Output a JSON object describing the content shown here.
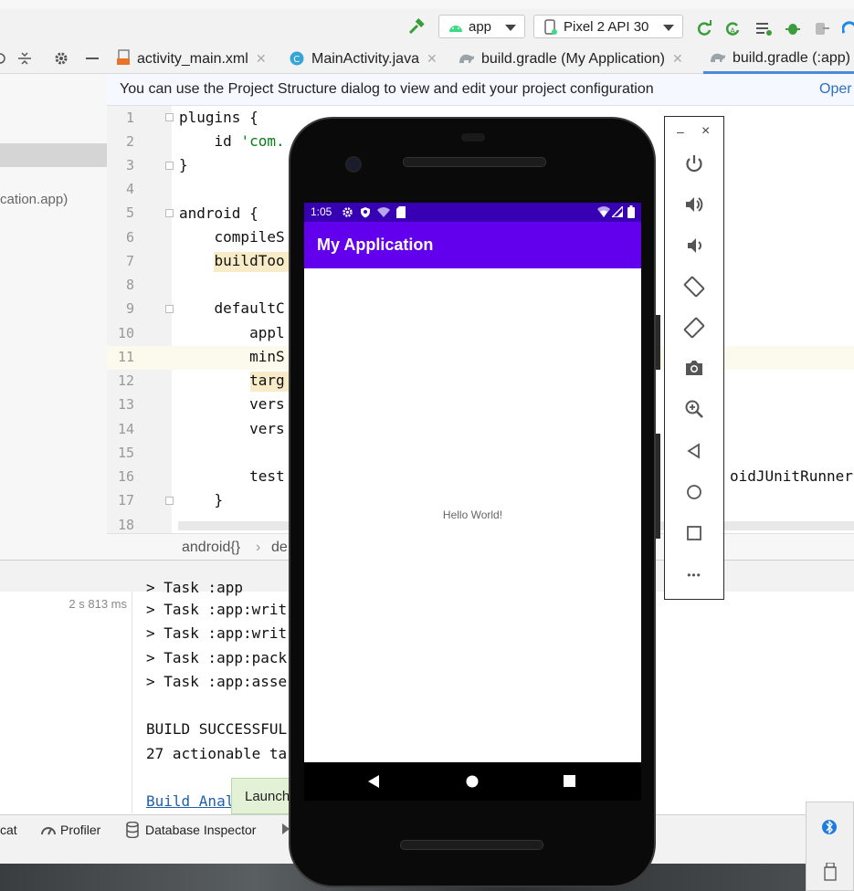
{
  "toolbar": {
    "run_config": "app",
    "device": "Pixel 2 API 30"
  },
  "tabs": [
    {
      "label": "activity_main.xml"
    },
    {
      "label": "MainActivity.java"
    },
    {
      "label": "build.gradle (My Application)"
    },
    {
      "label": "build.gradle (:app)"
    }
  ],
  "left_panel": {
    "project_item": "cation.app)"
  },
  "notice": {
    "text": "You can use the Project Structure dialog to view and edit your project configuration",
    "action": "Oper"
  },
  "editor": {
    "line_numbers": [
      "1",
      "2",
      "3",
      "4",
      "5",
      "6",
      "7",
      "8",
      "9",
      "10",
      "11",
      "12",
      "13",
      "14",
      "15",
      "16",
      "17",
      "18"
    ],
    "lines": [
      "plugins {",
      "    id 'com.",
      "}",
      "",
      "android {",
      "    compileS",
      "    buildToo",
      "",
      "    defaultC",
      "        appl",
      "        minS",
      "        targ",
      "        vers",
      "        vers",
      "",
      "        test",
      "    }",
      ""
    ],
    "line16_tail": "oidJUnitRunner"
  },
  "breadcrumbs": {
    "item1": "android{}",
    "item2": "de"
  },
  "build": {
    "duration": "2 s 813 ms",
    "console_lines": [
      "> Task :app:writ",
      "> Task :app:writ",
      "> Task :app:pack",
      "> Task :app:asse",
      "",
      "BUILD SUCCESSFUL",
      "27 actionable ta"
    ],
    "link": "Build Anal"
  },
  "toast": {
    "text": "Launch"
  },
  "statusbar": {
    "logcat": "cat",
    "profiler": "Profiler",
    "database": "Database Inspector"
  },
  "phone": {
    "time": "1:05",
    "app_title": "My Application",
    "hello": "Hello World!"
  },
  "emulator_panel": {
    "minimize": "–",
    "close": "×",
    "more": "•••"
  },
  "colors": {
    "status_bar": "#3700b3",
    "app_bar": "#6200ee",
    "toast_bg": "#e3f2d7",
    "link": "#1f5fae"
  }
}
